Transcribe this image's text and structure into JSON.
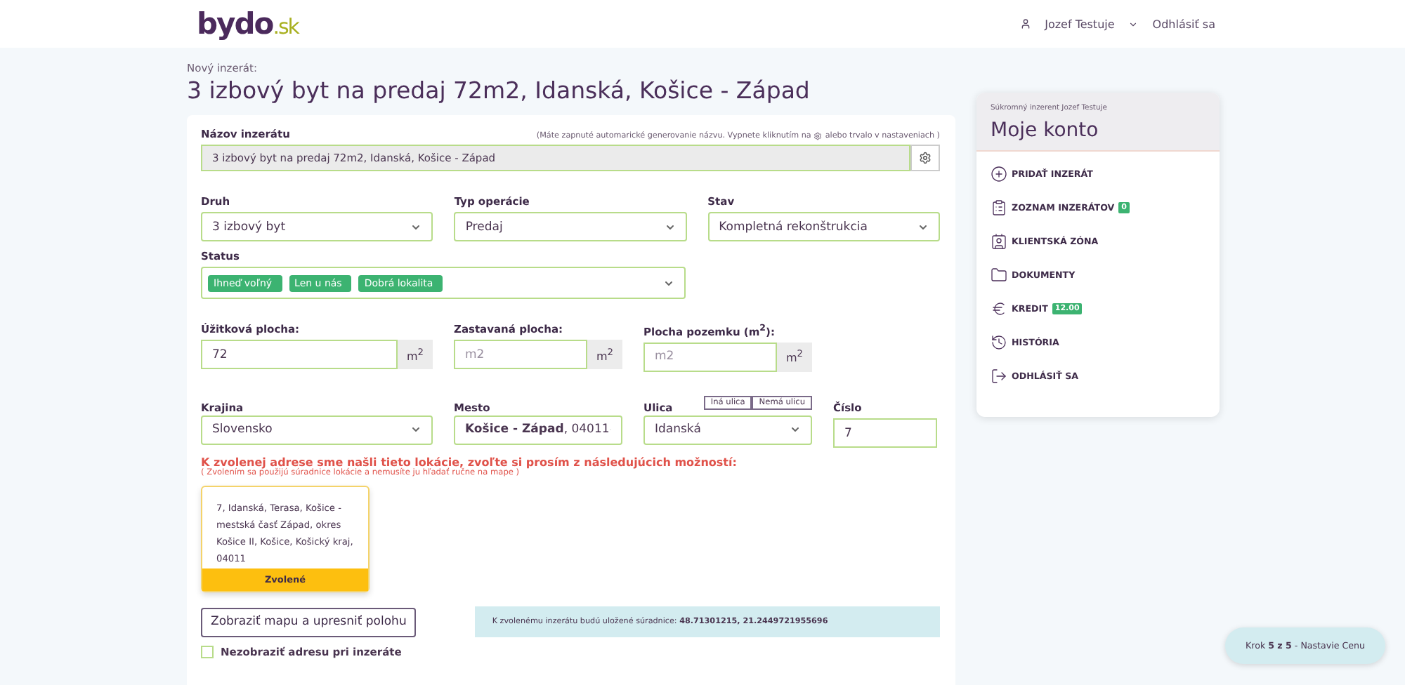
{
  "header": {
    "logo_main": "bydo",
    "logo_suffix": ".sk",
    "user": "Jozef Testuje",
    "logout": "Odhlásiť sa"
  },
  "page": {
    "subtitle": "Nový inzerát:",
    "title": "3 izbový byt na predaj 72m2, Idanská, Košice - Západ"
  },
  "name_field": {
    "label": "Názov inzerátu",
    "note_before": "(Máte zapnuté automarické generovanie názvu. Vypnete kliknutím na",
    "note_after": "alebo trvalo v nastaveniach )",
    "value": "3 izbový byt na predaj 72m2, Idanská, Košice - Západ"
  },
  "selects": [
    {
      "label": "Druh",
      "value": "3 izbový byt"
    },
    {
      "label": "Typ operácie",
      "value": "Predaj"
    },
    {
      "label": "Stav",
      "value": "Kompletná rekonštrukcia"
    }
  ],
  "status": {
    "label": "Status",
    "tags": [
      "Ihneď voľný",
      "Len u nás",
      "Dobrá lokalita"
    ]
  },
  "areas": [
    {
      "label": "Úžitková plocha:",
      "value": "72",
      "unit": "m$^{2}$"
    },
    {
      "label": "Zastavaná plocha:",
      "placeholder": "m2",
      "unit": "m$^{2}$"
    },
    {
      "label": "Plocha pozemku (m$^{2}$):",
      "placeholder": "m2",
      "unit": "m$^{2}$"
    }
  ],
  "address": [
    {
      "kind": "select",
      "label": "Krajina",
      "value": "Slovensko"
    },
    {
      "kind": "select",
      "label": "Mesto",
      "value": "**Košice - Západ**, 04011"
    },
    {
      "kind": "select",
      "label": "Ulica",
      "value": "Idanská",
      "buttons": [
        "Iná ulica",
        "Nemá ulicu"
      ]
    },
    {
      "kind": "input",
      "label": "Číslo",
      "value": "7"
    }
  ],
  "alert": {
    "title": "K zvolenej adrese sme našli tieto lokácie, zvoľte si prosím z následujúcich možností:",
    "hint": "( Zvolením sa použijú súradnice lokácie a nemusíte ju hľadať ručne na mape )"
  },
  "locations": [
    {
      "text": "7, Idanská, Terasa, Košice - mestská časť Západ, okres Košice II, Košice, Košický kraj, 04011",
      "button": "Zvolené",
      "selected": true
    }
  ],
  "map_button": "Zobraziť mapu a upresniť polohu",
  "coords_note": "K zvolenému inzerátu budú uložené súradnice: **48.71301215, 21.2449721955696**",
  "hide_address": {
    "label": "Nezobraziť adresu pri inzeráte",
    "checked": false
  },
  "sidebar": {
    "subtitle": "Súkromný inzerent Jozef Testuje",
    "title": "Moje konto",
    "items": [
      {
        "label": "PRIDAŤ INZERÁT"
      },
      {
        "label": "ZOZNAM INZERÁTOV",
        "badge": "0"
      },
      {
        "label": "KLIENTSKÁ ZÓNA"
      },
      {
        "label": "DOKUMENTY"
      },
      {
        "label": "KREDIT",
        "badge": "12.00"
      },
      {
        "label": "HISTÓRIA"
      },
      {
        "label": "ODHLÁSIŤ SA"
      }
    ]
  },
  "step": "Krok **5 z 5** - Nastavie Cenu"
}
